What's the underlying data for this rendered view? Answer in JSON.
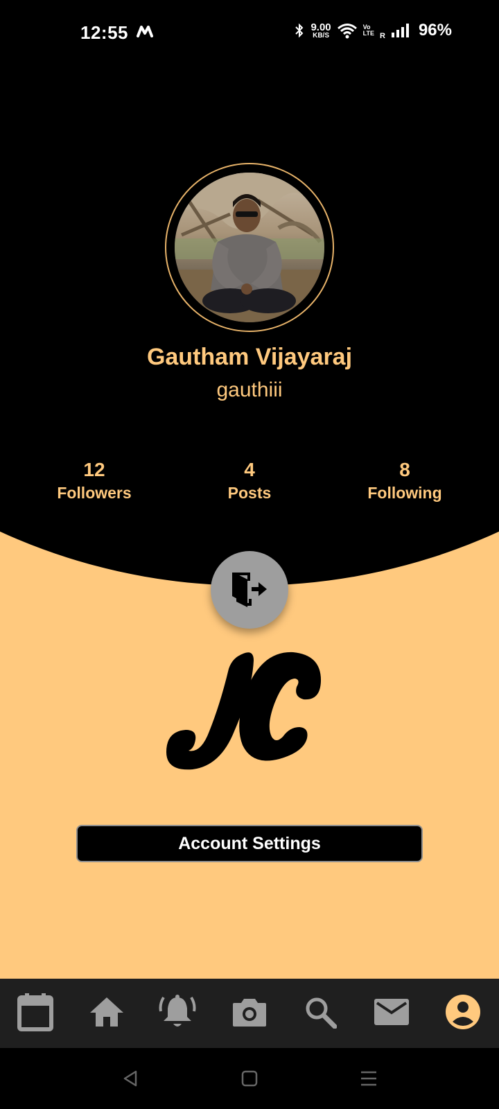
{
  "status_bar": {
    "time": "12:55",
    "net_speed_value": "9.00",
    "net_speed_unit": "KB/S",
    "volte_top": "Vo",
    "volte_bottom": "LTE",
    "roaming": "R",
    "battery": "96%"
  },
  "profile": {
    "name": "Gautham Vijayaraj",
    "handle": "gauthiii"
  },
  "stats": [
    {
      "value": "12",
      "label": "Followers"
    },
    {
      "value": "4",
      "label": "Posts"
    },
    {
      "value": "8",
      "label": "Following"
    }
  ],
  "settings_button": "Account Settings",
  "bottom_nav": [
    {
      "icon": "calendar-icon",
      "active": false
    },
    {
      "icon": "home-icon",
      "active": false
    },
    {
      "icon": "bell-icon",
      "active": false
    },
    {
      "icon": "camera-icon",
      "active": false
    },
    {
      "icon": "search-icon",
      "active": false
    },
    {
      "icon": "mail-icon",
      "active": false
    },
    {
      "icon": "account-circle-icon",
      "active": true
    }
  ],
  "colors": {
    "accent": "#FFC97E",
    "background_top": "#000000",
    "nav_bg": "#1F1F1F",
    "nav_inactive": "#9E9E9E",
    "logout_bg": "#9E9E9E"
  }
}
